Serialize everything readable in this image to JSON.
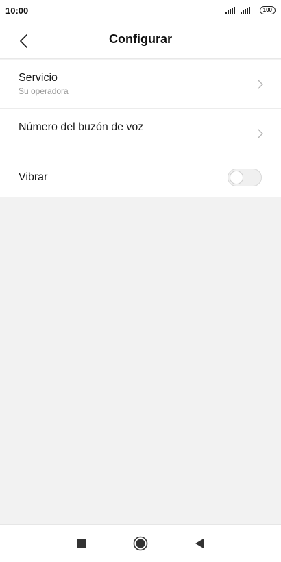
{
  "status_bar": {
    "time": "10:00",
    "battery": "100",
    "icons": [
      "signal-icon",
      "signal-icon",
      "battery-icon"
    ]
  },
  "header": {
    "title": "Configurar",
    "back_icon": "back-chevron-icon"
  },
  "settings": {
    "items": [
      {
        "title": "Servicio",
        "subtitle": "Su operadora",
        "icon": "chevron-right-icon"
      },
      {
        "title": "Número del buzón de voz",
        "icon": "chevron-right-icon"
      },
      {
        "title": "Vibrar",
        "toggle_on": false
      }
    ]
  },
  "nav_bar": {
    "icons": [
      "recents-square-icon",
      "home-circle-icon",
      "back-triangle-icon"
    ]
  },
  "colors": {
    "background": "#f2f2f2",
    "surface": "#ffffff",
    "text": "#111111",
    "subtext": "#9a9a9a"
  }
}
